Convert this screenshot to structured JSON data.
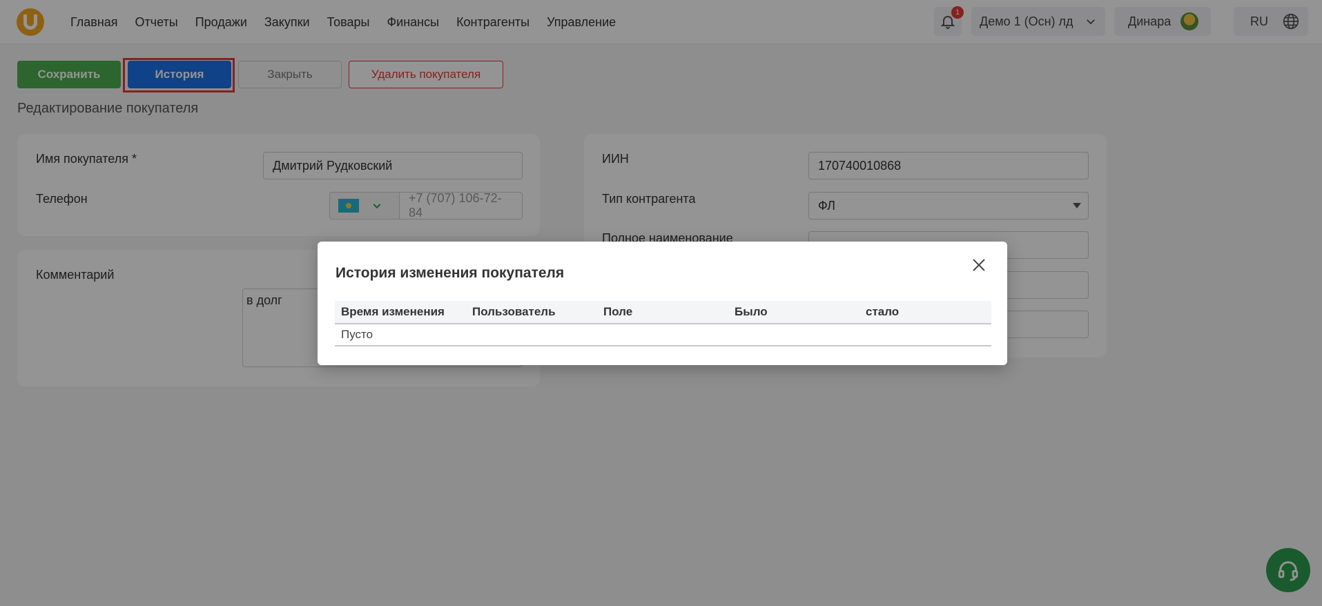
{
  "header": {
    "nav": [
      "Главная",
      "Отчеты",
      "Продажи",
      "Закупки",
      "Товары",
      "Финансы",
      "Контрагенты",
      "Управление"
    ],
    "notifications_count": "1",
    "org": "Демо 1 (Осн) лд",
    "user": "Динара",
    "lang": "RU"
  },
  "toolbar": {
    "save_label": "Сохранить",
    "history_label": "История",
    "close_label": "Закрыть",
    "delete_label": "Удалить покупателя"
  },
  "page": {
    "title": "Редактирование покупателя"
  },
  "form": {
    "name_label": "Имя покупателя *",
    "name_value": "Дмитрий Рудковский",
    "phone_label": "Телефон",
    "phone_value": "+7 (707) 106-72-84",
    "comment_label": "Комментарий",
    "comment_value": "в долг",
    "iin_label": "ИИН",
    "iin_value": "170740010868",
    "type_label": "Тип контрагента",
    "type_value": "ФЛ",
    "full_name_label": "Полное наименование"
  },
  "modal": {
    "title": "История изменения покупателя",
    "columns": [
      "Время изменения",
      "Пользователь",
      "Поле",
      "Было",
      "стало"
    ],
    "empty_text": "Пусто"
  },
  "colors": {
    "save": "#4caf50",
    "history": "#1a73e8",
    "delete": "#e53935",
    "highlight": "#e53935",
    "support": "#2e9e4f"
  },
  "icons": [
    "logo-icon",
    "bell-icon",
    "chevron-down-icon",
    "avatar",
    "globe-icon",
    "close-icon",
    "headset-icon"
  ]
}
